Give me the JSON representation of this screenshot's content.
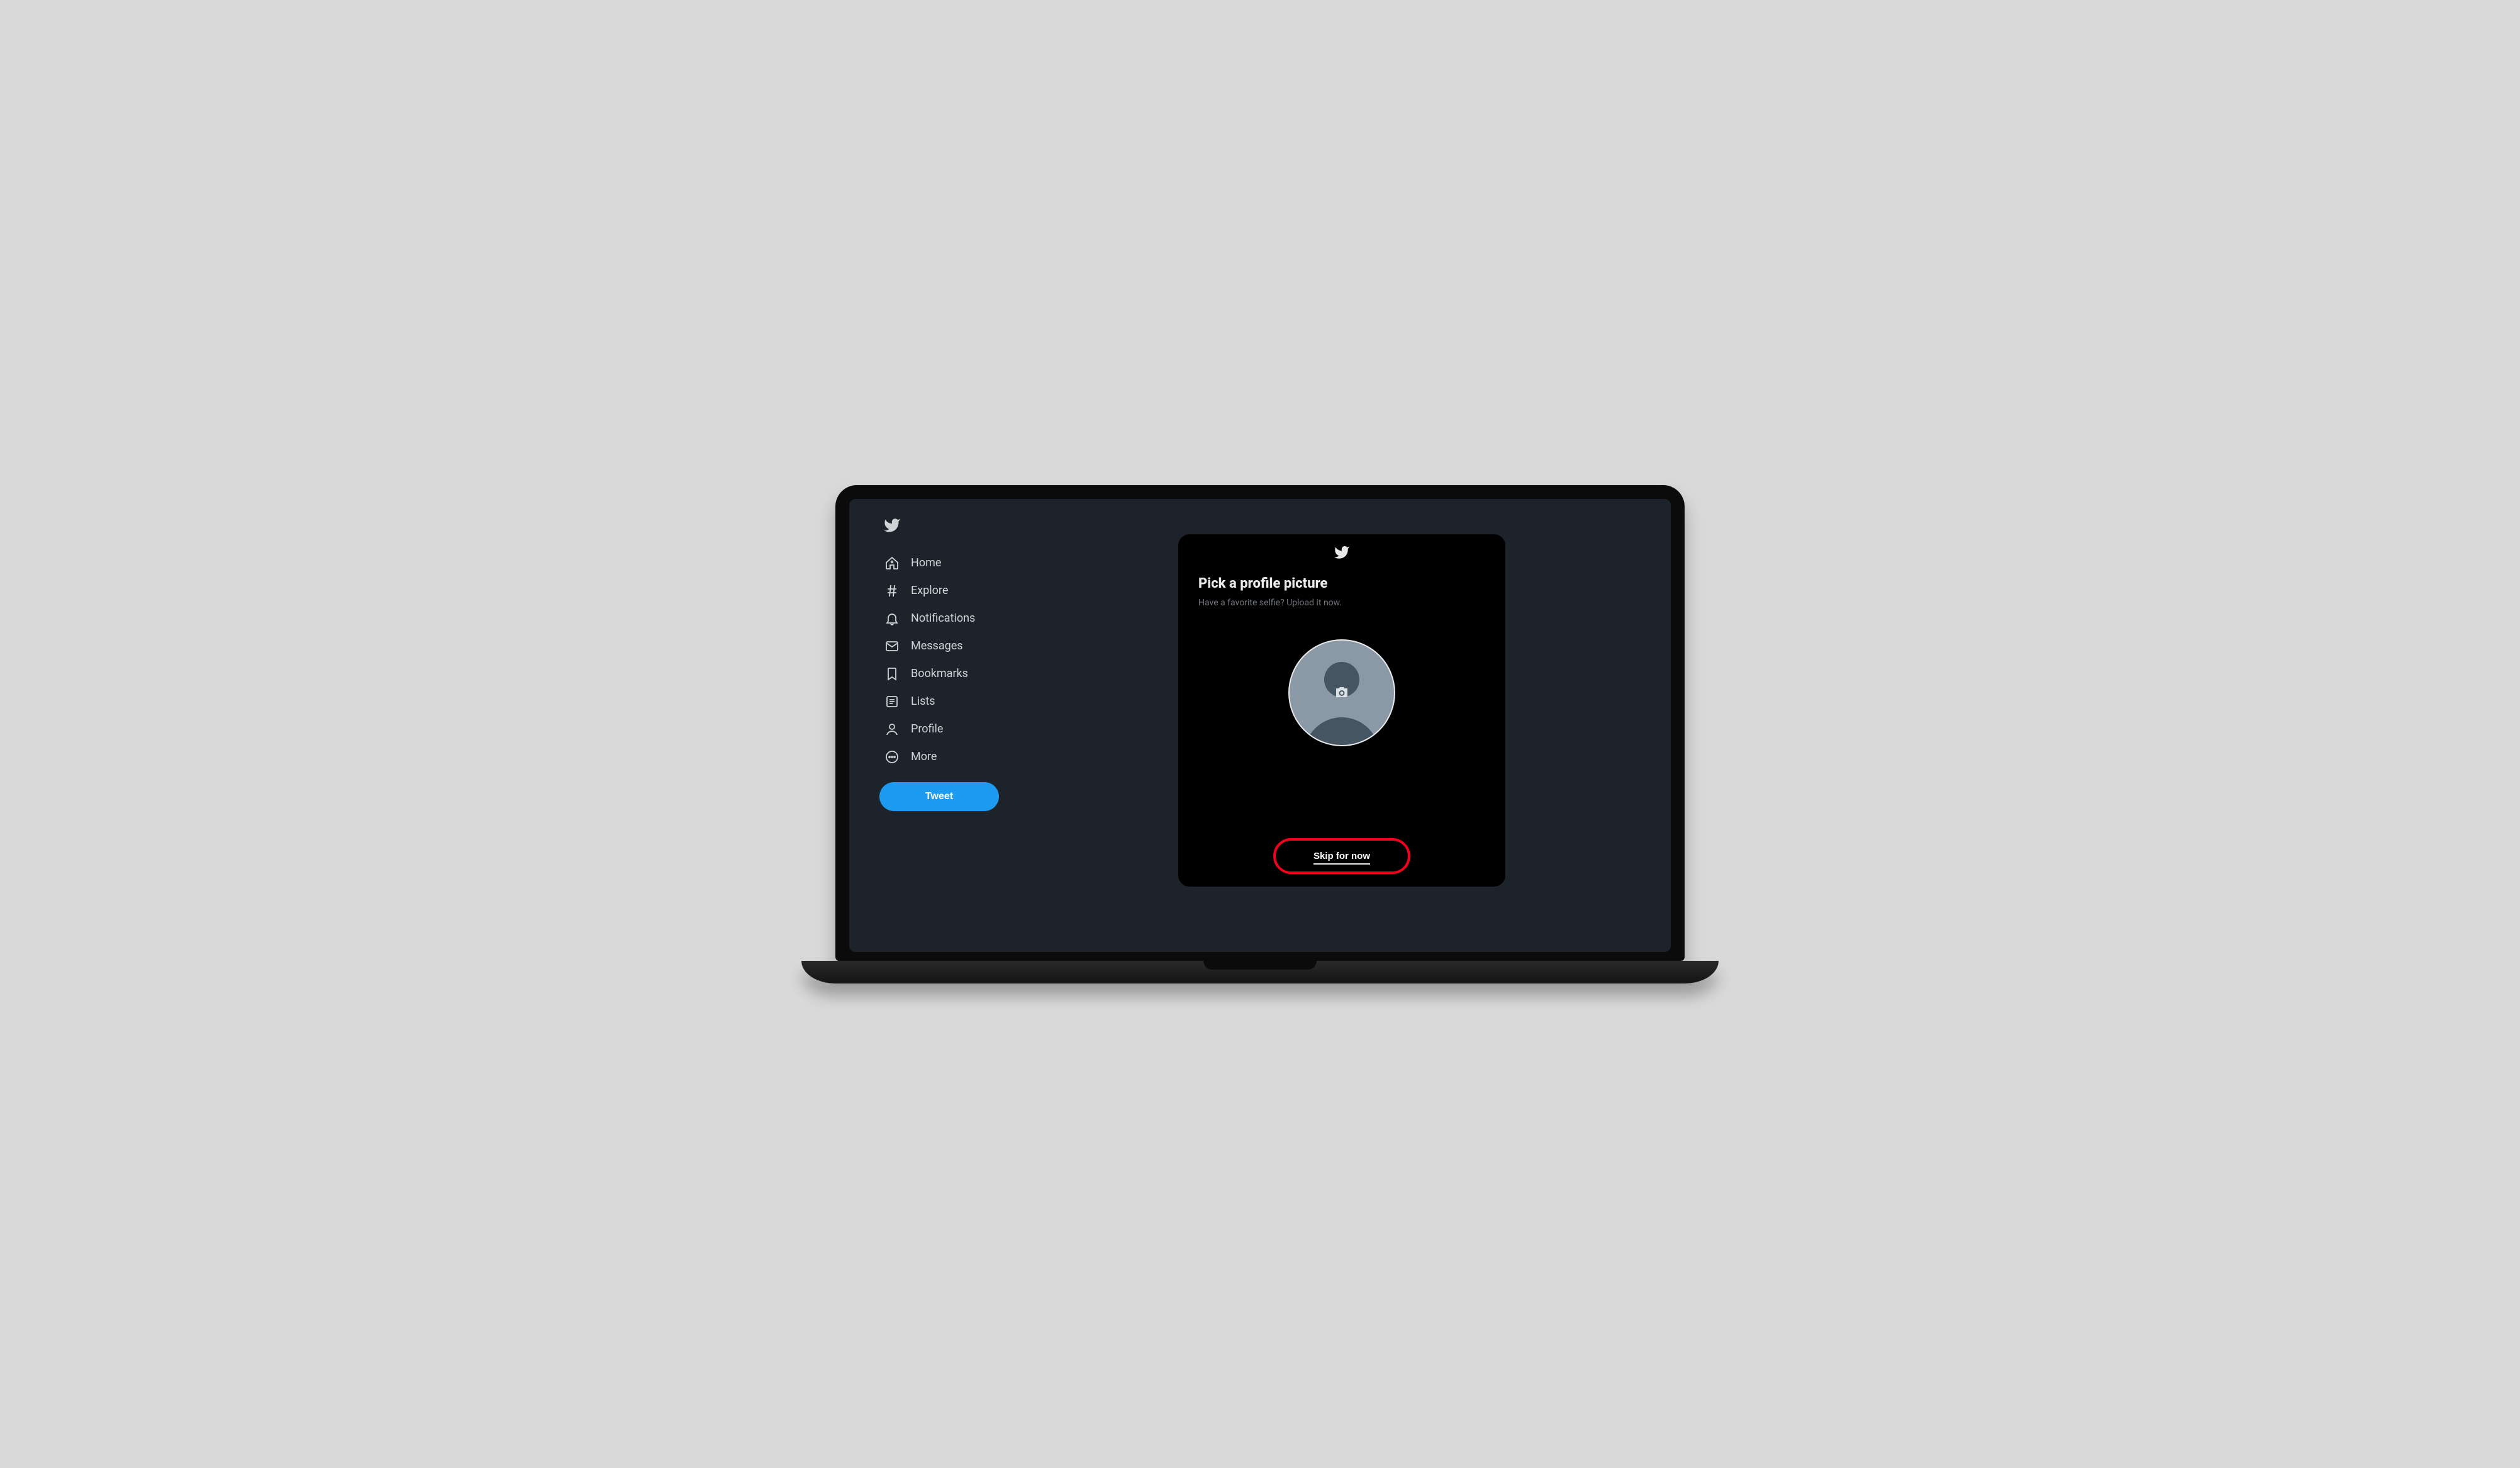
{
  "sidebar": {
    "items": [
      {
        "label": "Home"
      },
      {
        "label": "Explore"
      },
      {
        "label": "Notifications"
      },
      {
        "label": "Messages"
      },
      {
        "label": "Bookmarks"
      },
      {
        "label": "Lists"
      },
      {
        "label": "Profile"
      },
      {
        "label": "More"
      }
    ],
    "tweet_button_label": "Tweet"
  },
  "modal": {
    "title": "Pick a profile picture",
    "subtitle": "Have a favorite selfie? Upload it now.",
    "skip_label": "Skip for now"
  },
  "colors": {
    "background": "#1d232a",
    "modal_bg": "#000000",
    "accent": "#1d9bf0",
    "highlight": "#f3001d"
  }
}
